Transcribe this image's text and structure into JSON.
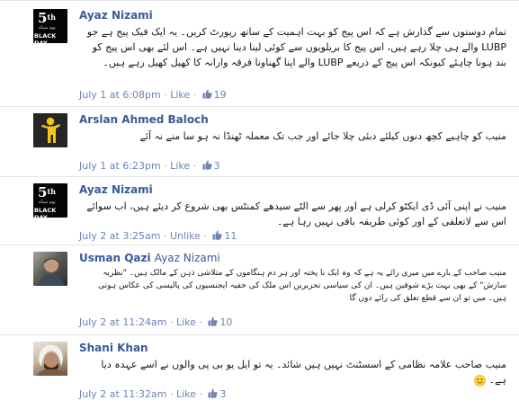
{
  "comments": [
    {
      "author": "Ayaz Nizami",
      "reply_to": "",
      "avatar": {
        "type": "black-day-badge",
        "number": "5",
        "sup": "th",
        "urdu": "یوم سیاہ",
        "caption": "BLACK DAY"
      },
      "text": "تمام دوستوں سے گذارش ہے کہ اس پیج کو بہت اہمیت کے ساتھ رپورٹ کریں۔ یہ ایک فیک پیج ہے جو LUBP والے ہی چلا رہے ہیں، اس پیج کا بریلویوں سے کوئی لینا دینا نہیں ہے۔ اس لئے بھی اس پیج کو بند ہونا چاہئے کیونکہ اس پیج کے ذریعے LUBP والے اپنا گھناونا فرقہ وارانہ کا کھیل کھیل رہے ہیں۔",
      "time": "July 1 at 6:08pm",
      "like_action": "Like",
      "like_count": "19"
    },
    {
      "author": "Arslan Ahmed Baloch",
      "reply_to": "",
      "avatar": {
        "type": "yellow-figure"
      },
      "text": "منیب کو چاہیے کچھ دنوں کیلئے دبئی چلا جائے اور جب تک معملہ ٹھنڈا نہ ہو سا منے نہ آئے",
      "time": "July 1 at 6:23pm",
      "like_action": "Like",
      "like_count": "3"
    },
    {
      "author": "Ayaz Nizami",
      "reply_to": "",
      "avatar": {
        "type": "black-day-badge",
        "number": "5",
        "sup": "th",
        "urdu": "یوم سیاہ",
        "caption": "BLACK DAY"
      },
      "text": "منیب نے اپنی آئی ڈی ایکٹو کرلی ہے اور پھر سے الٹے سیدھے کمنٹس بھی شروع کر دیئے ہیں، اب سوائے اس سے لاتعلقی کے اور کوئی طریقہ باقی نہیں رہا ہے۔",
      "time": "July 2 at 3:25am",
      "like_action": "Unlike",
      "like_count": "11"
    },
    {
      "author": "Usman Qazi",
      "reply_to": "Ayaz Nizami",
      "avatar": {
        "type": "photo"
      },
      "text": "منیب صاحب کے بارے میں میری رائے یہ ہے کہ وہ ایک نا پختہ اور ہر دم ہنگاموں کے متلاشی ذہن کے مالک ہیں۔ \"نظریہ سازش\" کے بھی بہت بڑے شوقین ہیں۔ ان کی سیاسی تحریریں اس ملک کی خفیہ ایجنسیوں کی پالیسی کی عکاس ہوتی ہیں۔ میں تو ان سے قطع تعلق کی رائے دوں گا",
      "time": "July 2 at 11:24am",
      "like_action": "Like",
      "like_count": "10"
    },
    {
      "author": "Shani Khan",
      "reply_to": "",
      "avatar": {
        "type": "photo"
      },
      "text": "منیب صاحب علامہ نظامی کے اسسٹنٹ نہیں ہیں شائد۔ یہ تو ایل یو بی پی والوں نے اسے عہدہ دیا ہے۔",
      "time": "July 2 at 11:32am",
      "like_action": "Like",
      "like_count": "3"
    }
  ],
  "separator": "·",
  "colors": {
    "link": "#3b5998",
    "meta": "#9197a3",
    "like": "#6d84b4",
    "text": "#141823"
  },
  "icons": {
    "like": "thumbs-up-icon",
    "emoji": "smile-emoji-icon"
  }
}
